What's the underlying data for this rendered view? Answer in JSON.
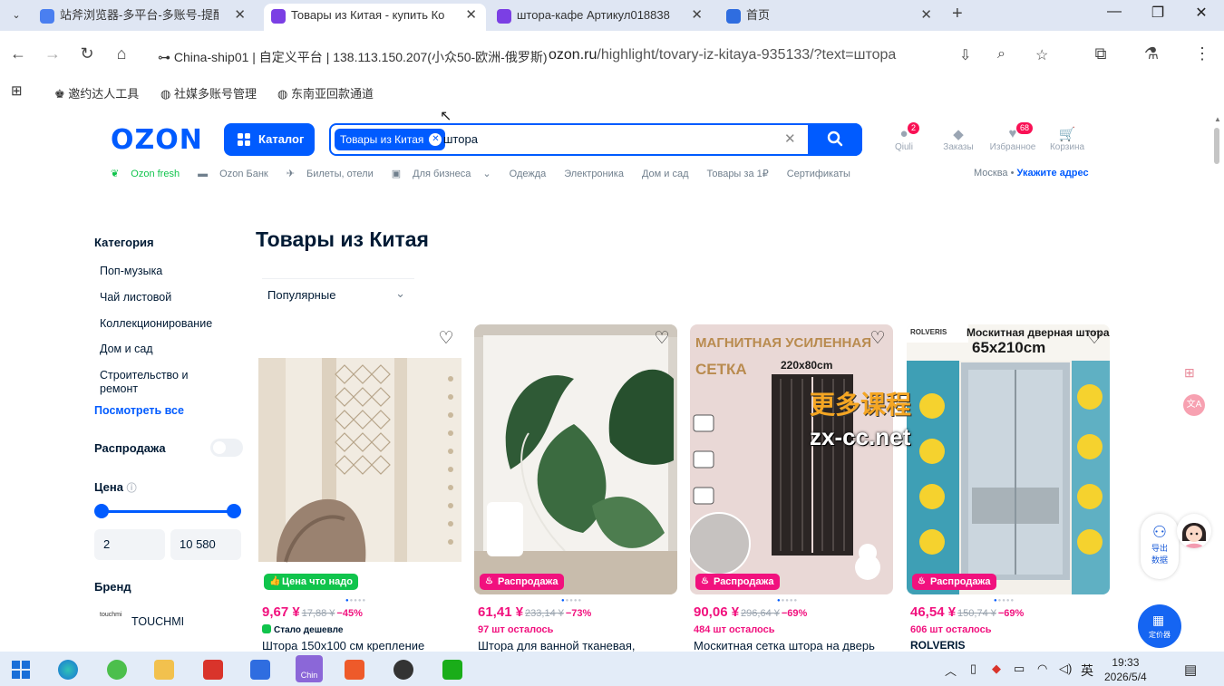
{
  "browser": {
    "tabs": [
      {
        "title": "站斧浏览器-多平台-多账号-提醒",
        "color": "#4a7ff0",
        "active": false
      },
      {
        "title": "Товары из Китая - купить Ко",
        "color": "#7b3fe4",
        "active": true
      },
      {
        "title": "штора-кафе Артикул018838",
        "color": "#7b3fe4",
        "active": false
      },
      {
        "title": "首页",
        "color": "#2f6de0",
        "active": false
      }
    ],
    "site_info": "China-ship01 | 自定义平台 | 138.113.150.207(小众50-欧洲-俄罗斯)",
    "url_host": "ozon.ru",
    "url_path": "/highlight/tovary-iz-kitaya-935133/?text=штора",
    "bookmarks": [
      "邀约达人工具",
      "社媒多账号管理",
      "东南亚回款通道"
    ]
  },
  "header": {
    "logo": "OZON",
    "catalog_label": "Каталог",
    "search_chip": "Товары из Китая",
    "search_value": "штора",
    "items": [
      {
        "label": "Qiuli",
        "icon": "user-icon",
        "badge": "2"
      },
      {
        "label": "Заказы",
        "icon": "box-icon",
        "badge": ""
      },
      {
        "label": "Избранное",
        "icon": "heart-icon",
        "badge": "68"
      },
      {
        "label": "Корзина",
        "icon": "cart-icon",
        "badge": ""
      }
    ],
    "subnav": [
      "Ozon fresh",
      "Ozon Банк",
      "Билеты, отели",
      "Для бизнеса",
      "Одежда",
      "Электроника",
      "Дом и сад",
      "Товары за 1₽",
      "Сертификаты"
    ],
    "city": "Москва",
    "address_link": "Укажите адрес"
  },
  "sidebar": {
    "category_title": "Категория",
    "categories": [
      "Поп-музыка",
      "Чай листовой",
      "Коллекционирование",
      "Дом и сад",
      "Строительство и",
      "ремонт"
    ],
    "see_all": "Посмотреть все",
    "sale_label": "Распродажа",
    "sale_on": false,
    "price_title": "Цена",
    "price_from": "2",
    "price_to": "10 580",
    "brand_title": "Бренд",
    "brand_name": "TOUCHMI",
    "brand_logo_text": "touchmi"
  },
  "main": {
    "title": "Товары из Китая",
    "sort_value": "Популярные",
    "products": [
      {
        "tag": "Цена что надо",
        "tag_type": "deal",
        "price": "9,67 ¥",
        "old_price": "17,88 ¥",
        "discount": "−45%",
        "note": "Стало дешевле",
        "stock": "",
        "title": "Штора 150x100 см крепление"
      },
      {
        "tag": "Распродажа",
        "tag_type": "sale",
        "price": "61,41 ¥",
        "old_price": "233,14 ¥",
        "discount": "−73%",
        "note": "",
        "stock": "97 шт осталось",
        "title": "Штора для ванной тканевая,"
      },
      {
        "tag": "Распродажа",
        "tag_type": "sale",
        "price": "90,06 ¥",
        "old_price": "296,64 ¥",
        "discount": "−69%",
        "note": "",
        "stock": "484 шт осталось",
        "title": "Москитная сетка штора на дверь"
      },
      {
        "tag": "Распродажа",
        "tag_type": "sale",
        "price": "46,54 ¥",
        "old_price": "150,74 ¥",
        "discount": "−69%",
        "note": "",
        "stock": "606 шт осталось",
        "title": "ROLVERIS"
      }
    ],
    "card3_banner": "МАГНИТНАЯ УСИЛЕННАЯ",
    "card3_sub": "СЕТКА",
    "card3_size": "220x80cm",
    "card4_brand": "ROLVERIS",
    "card4_banner": "Москитная дверная штора",
    "card4_size": "65x210cm"
  },
  "overlay": {
    "watermark_line1": "更多课程",
    "watermark_line2": "zx-cc.net",
    "export_label": "导出\n数据",
    "pricer_label": "定价器"
  },
  "taskbar": {
    "lang": "英",
    "time": "19:33",
    "date": "2026/5/4",
    "app_label": "Chin"
  }
}
